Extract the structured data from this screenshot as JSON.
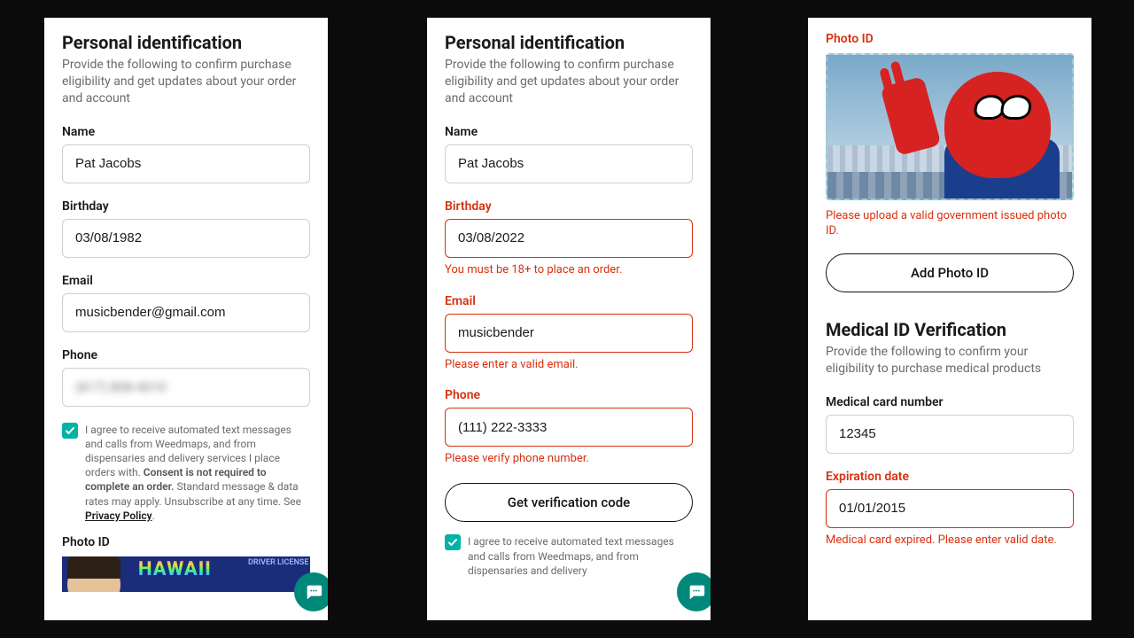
{
  "panel1": {
    "title": "Personal identification",
    "desc": "Provide the following to confirm purchase eligibility and get updates about your order and account",
    "name_label": "Name",
    "name_value": "Pat Jacobs",
    "birthday_label": "Birthday",
    "birthday_value": "03/08/1982",
    "email_label": "Email",
    "email_value": "musicbender@gmail.com",
    "phone_label": "Phone",
    "phone_value": "(817) 808-4010",
    "consent_pre": "I agree to receive automated text messages and calls from Weedmaps, and from dispensaries and delivery services I place orders with. ",
    "consent_bold": "Consent is not required to complete an order.",
    "consent_post": " Standard message & data rates may apply. Unsubscribe at any time. See ",
    "consent_link": "Privacy Policy",
    "photoid_label": "Photo ID",
    "hawaii": "HAWAII",
    "hawaii_sub": "DRIVER LICENSE"
  },
  "panel2": {
    "title": "Personal identification",
    "desc": "Provide the following to confirm purchase eligibility and get updates about your order and account",
    "name_label": "Name",
    "name_value": "Pat Jacobs",
    "birthday_label": "Birthday",
    "birthday_value": "03/08/2022",
    "birthday_error": "You must be 18+ to place an order.",
    "email_label": "Email",
    "email_value": "musicbender",
    "email_error": "Please enter a valid email.",
    "phone_label": "Phone",
    "phone_value": "(111) 222-3333",
    "phone_error": "Please verify phone number.",
    "verify_btn": "Get verification code",
    "consent_pre": "I agree to receive automated text messages and calls from Weedmaps, and from dispensaries and delivery"
  },
  "panel3": {
    "photoid_label": "Photo ID",
    "photoid_error": "Please upload a valid government issued photo ID.",
    "add_photo_btn": "Add Photo ID",
    "medical_title": "Medical ID Verification",
    "medical_desc": "Provide the following to confirm your eligibility to purchase medical products",
    "card_label": "Medical card number",
    "card_value": "12345",
    "exp_label": "Expiration date",
    "exp_value": "01/01/2015",
    "exp_error": "Medical card expired. Please enter valid date."
  }
}
